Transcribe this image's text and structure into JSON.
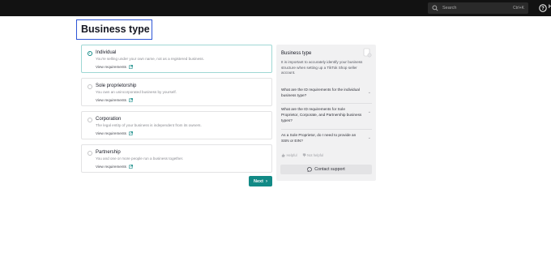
{
  "topbar": {
    "search_placeholder": "Search",
    "search_shortcut": "Ctrl+K",
    "right_label": "H"
  },
  "page": {
    "title": "Business type"
  },
  "options": [
    {
      "title": "Individual",
      "description": "You're selling under your own name, not as a registered business.",
      "link": "View requirements",
      "selected": true
    },
    {
      "title": "Sole proprietorship",
      "description": "You own an unincorporated business by yourself.",
      "link": "View requirements",
      "selected": false
    },
    {
      "title": "Corporation",
      "description": "The legal entity of your business is independent from its owners.",
      "link": "View requirements",
      "selected": false
    },
    {
      "title": "Partnership",
      "description": "You and one or more people run a business together.",
      "link": "View requirements",
      "selected": false
    }
  ],
  "next_button": "Next",
  "help_panel": {
    "title": "Business type",
    "description": "It is important to accurately identify your business structure when setting up a TikTok Shop seller account.",
    "faqs": [
      "What are the ID requirements for the individual business type?",
      "What are the ID requirements for Sole Proprietor, Corporate, and Partnership business types?",
      "As a Sole Proprietor, do I need to provide an SSN or EIN?"
    ],
    "helpful_label": "Helpful",
    "not_helpful_label": "Not helpful",
    "contact_label": "Contact support"
  },
  "colors": {
    "accent": "#128a86",
    "title_highlight": "#2d55d6",
    "topbar": "#121212"
  }
}
